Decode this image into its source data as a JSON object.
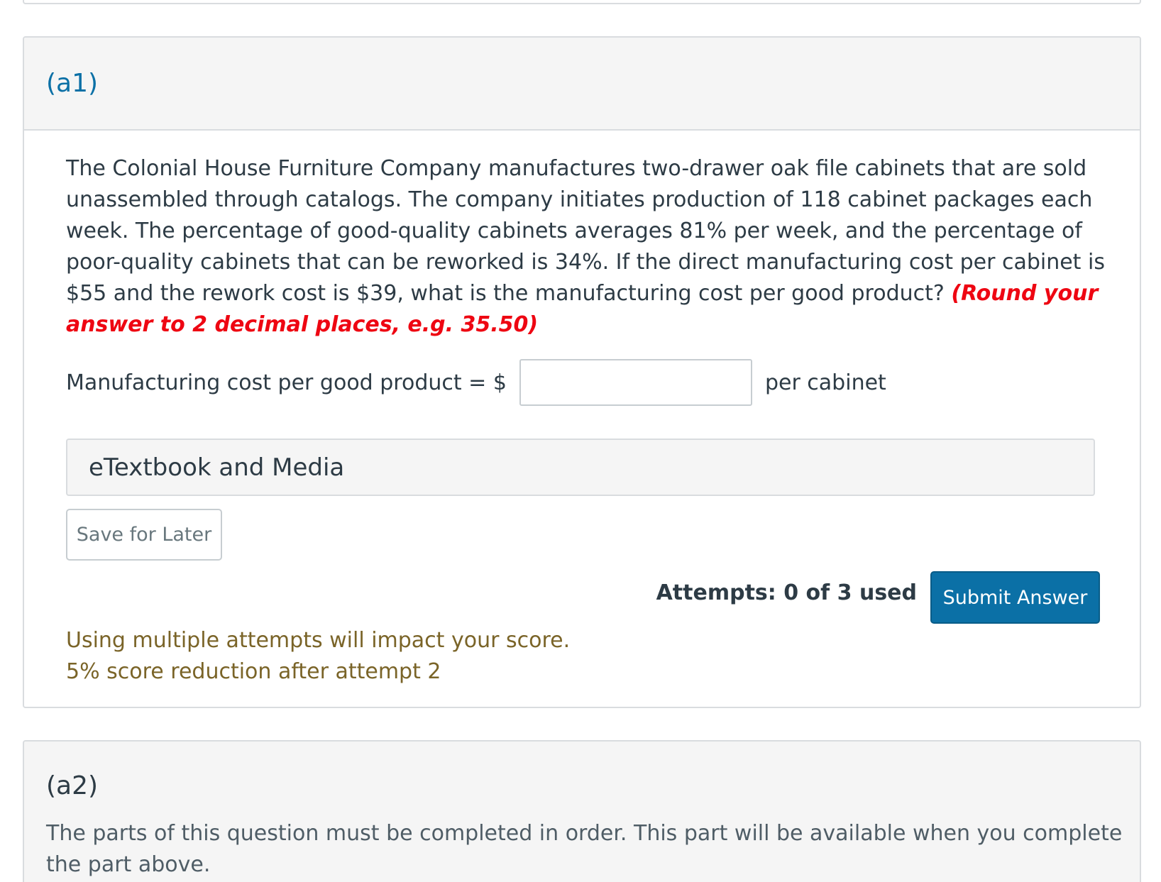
{
  "part_a1": {
    "label": "(a1)",
    "question": {
      "text": "The Colonial House Furniture Company manufactures two-drawer oak file cabinets that are sold unassembled through catalogs. The company initiates production of 118 cabinet packages each week. The percentage of good-quality cabinets averages 81% per week, and the percentage of poor-quality cabinets that can be reworked is 34%. If the direct manufacturing cost per cabinet is $55 and the rework cost is $39, what is the manufacturing cost per good product? ",
      "instruction": "(Round your answer to 2 decimal places, e.g. 35.50)"
    },
    "answer": {
      "label": "Manufacturing cost per good product = $",
      "value": "",
      "placeholder": "",
      "unit": "per cabinet"
    },
    "etextbook_label": "eTextbook and Media",
    "save_label": "Save for Later",
    "attempts_text": "Attempts: 0 of 3 used",
    "submit_label": "Submit Answer",
    "warning_line1": "Using multiple attempts will impact your score.",
    "warning_line2": "5% score reduction after attempt 2"
  },
  "part_a2": {
    "label": "(a2)",
    "locked_message": "The parts of this question must be completed in order. This part will be available when you complete the part above."
  },
  "colors": {
    "accent": "#0b70a6",
    "emphasis": "#ee0612",
    "warning": "#7a6428",
    "panel_bg": "#f5f5f5",
    "border": "#d9dcdf"
  }
}
